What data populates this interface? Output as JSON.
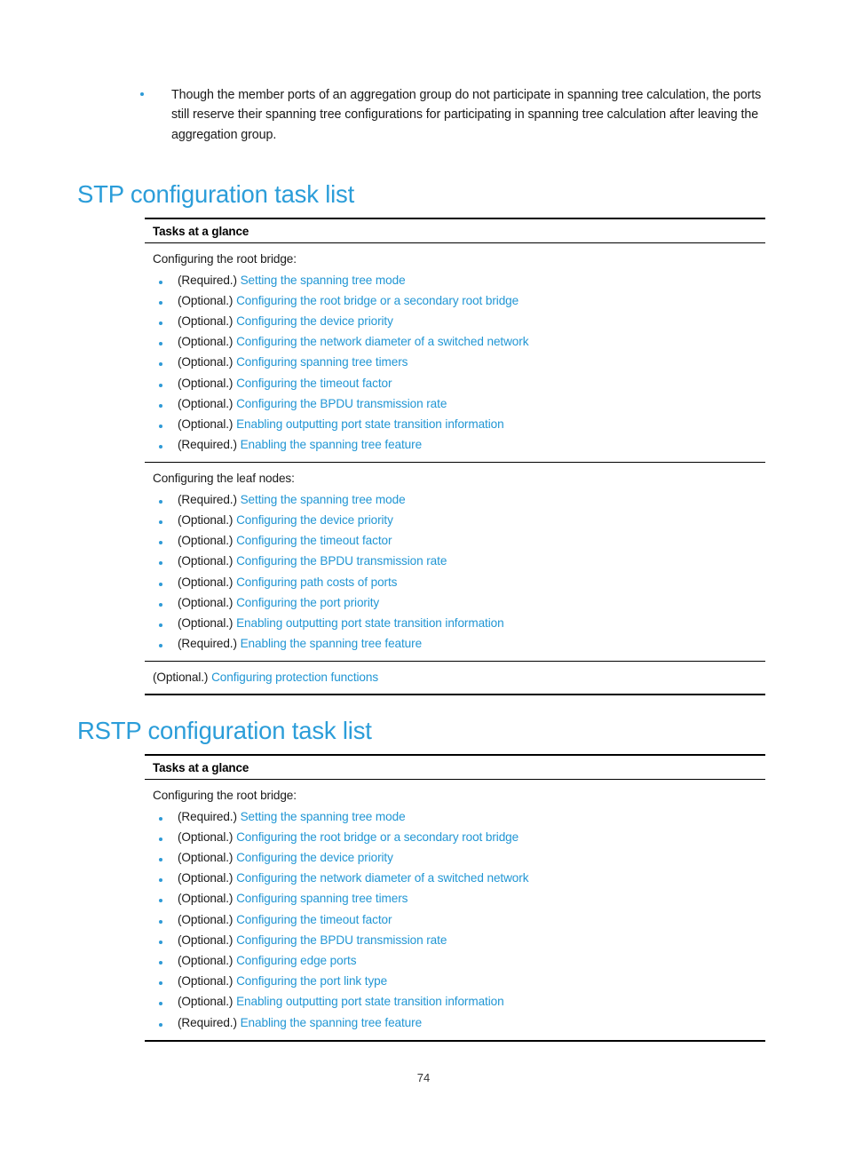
{
  "document": {
    "page_number": "74",
    "colors": {
      "heading_blue": "#2b9dd9",
      "link_blue": "#2196d4",
      "bullet_blue": "#2e9ad6",
      "body_black": "#1a1a1a"
    }
  },
  "intro": {
    "bullets": [
      "Though the member ports of an aggregation group do not participate in spanning tree calculation, the ports still reserve their spanning tree configurations for participating in spanning tree calculation after leaving the aggregation group."
    ]
  },
  "sections": [
    {
      "id": "stp",
      "heading": "STP configuration task list",
      "table": {
        "header": "Tasks at a glance",
        "groups": [
          {
            "lead": "Configuring the root bridge:",
            "items": [
              {
                "tag": "(Required.)",
                "link": "Setting the spanning tree mode"
              },
              {
                "tag": "(Optional.)",
                "link": "Configuring the root bridge or a secondary root bridge"
              },
              {
                "tag": "(Optional.)",
                "link": "Configuring the device priority"
              },
              {
                "tag": "(Optional.)",
                "link": "Configuring the network diameter of a switched network"
              },
              {
                "tag": "(Optional.)",
                "link": "Configuring spanning tree timers"
              },
              {
                "tag": "(Optional.)",
                "link": "Configuring the timeout factor"
              },
              {
                "tag": "(Optional.)",
                "link": "Configuring the BPDU transmission rate"
              },
              {
                "tag": "(Optional.)",
                "link": "Enabling outputting port state transition information"
              },
              {
                "tag": "(Required.)",
                "link": "Enabling the spanning tree feature"
              }
            ]
          },
          {
            "lead": "Configuring the leaf nodes:",
            "items": [
              {
                "tag": "(Required.)",
                "link": "Setting the spanning tree mode"
              },
              {
                "tag": "(Optional.)",
                "link": "Configuring the device priority"
              },
              {
                "tag": "(Optional.)",
                "link": "Configuring the timeout factor"
              },
              {
                "tag": "(Optional.)",
                "link": "Configuring the BPDU transmission rate"
              },
              {
                "tag": "(Optional.)",
                "link": "Configuring path costs of ports"
              },
              {
                "tag": "(Optional.)",
                "link": "Configuring the port priority"
              },
              {
                "tag": "(Optional.)",
                "link": "Enabling outputting port state transition information"
              },
              {
                "tag": "(Required.)",
                "link": "Enabling the spanning tree feature"
              }
            ]
          }
        ],
        "plain_row": {
          "tag": "(Optional.)",
          "link": "Configuring protection functions"
        }
      }
    },
    {
      "id": "rstp",
      "heading": "RSTP configuration task list",
      "table": {
        "header": "Tasks at a glance",
        "groups": [
          {
            "lead": "Configuring the root bridge:",
            "items": [
              {
                "tag": "(Required.)",
                "link": "Setting the spanning tree mode"
              },
              {
                "tag": "(Optional.)",
                "link": "Configuring the root bridge or a secondary root bridge"
              },
              {
                "tag": "(Optional.)",
                "link": "Configuring the device priority"
              },
              {
                "tag": "(Optional.)",
                "link": "Configuring the network diameter of a switched network"
              },
              {
                "tag": "(Optional.)",
                "link": "Configuring spanning tree timers"
              },
              {
                "tag": "(Optional.)",
                "link": "Configuring the timeout factor"
              },
              {
                "tag": "(Optional.)",
                "link": "Configuring the BPDU transmission rate"
              },
              {
                "tag": "(Optional.)",
                "link": "Configuring edge ports"
              },
              {
                "tag": "(Optional.)",
                "link": "Configuring the port link type"
              },
              {
                "tag": "(Optional.)",
                "link": "Enabling outputting port state transition information"
              },
              {
                "tag": "(Required.)",
                "link": "Enabling the spanning tree feature"
              }
            ]
          }
        ],
        "plain_row": null
      }
    }
  ]
}
